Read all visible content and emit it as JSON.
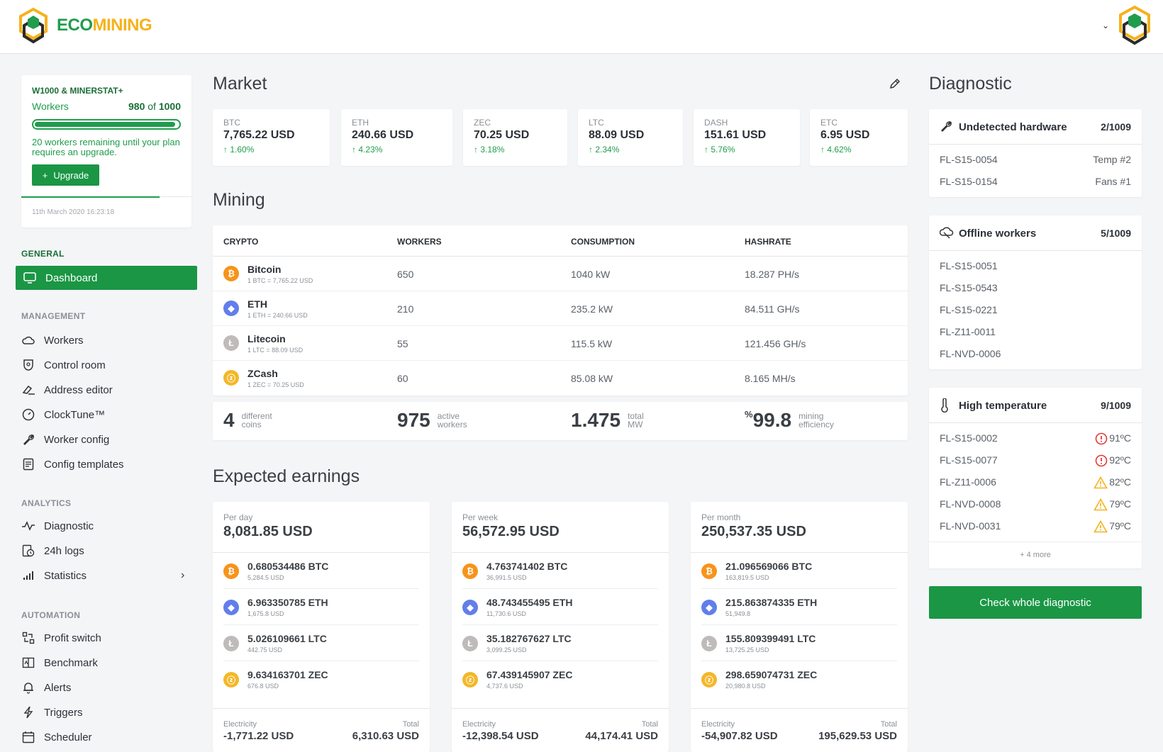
{
  "brand": {
    "eco": "ECO",
    "mining": "MINING"
  },
  "plan": {
    "name": "W1000 & MINERSTAT+",
    "workers_label": "Workers",
    "workers_used": "980",
    "workers_of": " of ",
    "workers_total": "1000",
    "usage_fraction": 0.98,
    "note": "20 workers remaining until your plan requires an upgrade.",
    "upgrade_label": "Upgrade",
    "date": "11th March 2020 16:23:18"
  },
  "nav": {
    "general": "GENERAL",
    "dashboard": "Dashboard",
    "management": "MANAGEMENT",
    "workers": "Workers",
    "control_room": "Control room",
    "address_editor": "Address editor",
    "clocktune": "ClockTune™",
    "worker_config": "Worker config",
    "config_templates": "Config templates",
    "analytics": "ANALYTICS",
    "diagnostic": "Diagnostic",
    "logs": "24h logs",
    "statistics": "Statistics",
    "automation": "AUTOMATION",
    "profit_switch": "Profit switch",
    "benchmark": "Benchmark",
    "alerts": "Alerts",
    "triggers": "Triggers",
    "scheduler": "Scheduler"
  },
  "market": {
    "title": "Market",
    "cards": [
      {
        "sym": "BTC",
        "price": "7,765.22 USD",
        "change": "↑ 1.60%"
      },
      {
        "sym": "ETH",
        "price": "240.66 USD",
        "change": "↑ 4.23%"
      },
      {
        "sym": "ZEC",
        "price": "70.25 USD",
        "change": "↑ 3.18%"
      },
      {
        "sym": "LTC",
        "price": "88.09 USD",
        "change": "↑ 2.34%"
      },
      {
        "sym": "DASH",
        "price": "151.61 USD",
        "change": "↑ 5.76%"
      },
      {
        "sym": "ETC",
        "price": "6.95 USD",
        "change": "↑ 4.62%"
      }
    ]
  },
  "mining": {
    "title": "Mining",
    "headers": {
      "crypto": "CRYPTO",
      "workers": "WORKERS",
      "consumption": "CONSUMPTION",
      "hashrate": "HASHRATE"
    },
    "rows": [
      {
        "name": "Bitcoin",
        "rate": "1 BTC = 7,765.22 USD",
        "workers": "650",
        "consumption": "1040 kW",
        "hashrate": "18.287 PH/s"
      },
      {
        "name": "ETH",
        "rate": "1 ETH = 240.66 USD",
        "workers": "210",
        "consumption": "235.2 kW",
        "hashrate": "84.511 GH/s"
      },
      {
        "name": "Litecoin",
        "rate": "1 LTC = 88.09 USD",
        "workers": "55",
        "consumption": "115.5 kW",
        "hashrate": "121.456 GH/s"
      },
      {
        "name": "ZCash",
        "rate": "1 ZEC = 70.25 USD",
        "workers": "60",
        "consumption": "85.08 kW",
        "hashrate": "8.165 MH/s"
      }
    ],
    "summary": {
      "coins": "4",
      "coins_l1": "different",
      "coins_l2": "coins",
      "workers": "975",
      "workers_l1": "active",
      "workers_l2": "workers",
      "mw": "1.475",
      "mw_l1": "total",
      "mw_l2": "MW",
      "eff_pct": "%",
      "eff": "99.8",
      "eff_l1": "mining",
      "eff_l2": "efficiency"
    }
  },
  "earnings": {
    "title": "Expected earnings",
    "electricity_label": "Electricity",
    "total_label": "Total",
    "cards": [
      {
        "period": "Per day",
        "total": "8,081.85 USD",
        "rows": [
          {
            "amt": "0.680534486 BTC",
            "usd": "5,284.5 USD"
          },
          {
            "amt": "6.963350785 ETH",
            "usd": "1,675.8 USD"
          },
          {
            "amt": "5.026109661 LTC",
            "usd": "442.75 USD"
          },
          {
            "amt": "9.634163701 ZEC",
            "usd": "676.8 USD"
          }
        ],
        "electricity": "-1,771.22 USD",
        "net": "6,310.63 USD"
      },
      {
        "period": "Per week",
        "total": "56,572.95 USD",
        "rows": [
          {
            "amt": "4.763741402 BTC",
            "usd": "36,991.5 USD"
          },
          {
            "amt": "48.743455495 ETH",
            "usd": "11,730.6 USD"
          },
          {
            "amt": "35.182767627 LTC",
            "usd": "3,099.25 USD"
          },
          {
            "amt": "67.439145907 ZEC",
            "usd": "4,737.6 USD"
          }
        ],
        "electricity": "-12,398.54 USD",
        "net": "44,174.41 USD"
      },
      {
        "period": "Per month",
        "total": "250,537.35 USD",
        "rows": [
          {
            "amt": "21.096569066 BTC",
            "usd": "163,819.5 USD"
          },
          {
            "amt": "215.863874335 ETH",
            "usd": "51,949.8"
          },
          {
            "amt": "155.809399491 LTC",
            "usd": "13,725.25 USD"
          },
          {
            "amt": "298.659074731 ZEC",
            "usd": "20,980.8 USD"
          }
        ],
        "electricity": "-54,907.82 USD",
        "net": "195,629.53 USD"
      }
    ]
  },
  "diagnostic": {
    "title": "Diagnostic",
    "undetected": {
      "title": "Undetected hardware",
      "count": "2/1009",
      "rows": [
        {
          "id": "FL-S15-0054",
          "issue": "Temp #2"
        },
        {
          "id": "FL-S15-0154",
          "issue": "Fans #1"
        }
      ]
    },
    "offline": {
      "title": "Offline workers",
      "count": "5/1009",
      "rows": [
        "FL-S15-0051",
        "FL-S15-0543",
        "FL-S15-0221",
        "FL-Z11-0011",
        "FL-NVD-0006"
      ]
    },
    "temp": {
      "title": "High temperature",
      "count": "9/1009",
      "rows": [
        {
          "id": "FL-S15-0002",
          "temp": "91ºC",
          "level": "critical"
        },
        {
          "id": "FL-S15-0077",
          "temp": "92ºC",
          "level": "critical"
        },
        {
          "id": "FL-Z11-0006",
          "temp": "82ºC",
          "level": "warning"
        },
        {
          "id": "FL-NVD-0008",
          "temp": "79ºC",
          "level": "warning"
        },
        {
          "id": "FL-NVD-0031",
          "temp": "79ºC",
          "level": "warning"
        }
      ],
      "more": "+ 4 more"
    },
    "check_label": "Check whole diagnostic"
  },
  "colors": {
    "accent": "#1a9645",
    "btc": "#f7931a",
    "eth": "#627eea",
    "ltc": "#bfbbbb",
    "zec": "#f4b728",
    "critical": "#e53935",
    "warning": "#f5b21b"
  }
}
